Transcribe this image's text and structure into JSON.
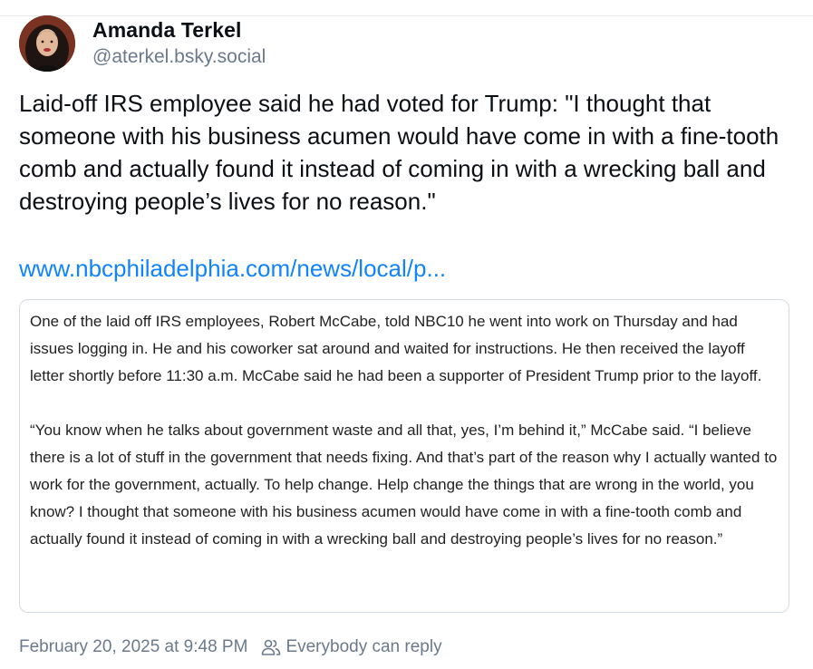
{
  "author": {
    "display_name": "Amanda Terkel",
    "handle": "@aterkel.bsky.social",
    "avatar_icon": "avatar-photo"
  },
  "post": {
    "text": "Laid-off IRS employee said he had voted for Trump: \"I thought that someone with his business acumen would have come in with a fine-tooth comb and actually found it instead of coming in with a wrecking ball and destroying people’s lives for no reason.\"",
    "link_text": "www.nbcphiladelphia.com/news/local/p..."
  },
  "quote": {
    "paragraph_1": "One of the laid off IRS employees, Robert McCabe, told NBC10 he went into work on Thursday and had issues logging in. He and his coworker sat around and waited for instructions. He then received the layoff letter shortly before 11:30 a.m. McCabe said he had been a supporter of President Trump prior to the layoff.",
    "paragraph_2": "“You know when he talks about government waste and all that, yes, I’m behind it,” McCabe said. “I believe there is a lot of stuff in the government that needs fixing. And that’s part of the reason why I actually wanted to work for the government, actually. To help change. Help change the things that are wrong in the world, you know? I thought that someone with his business acumen would have come in with a fine-tooth comb and actually found it instead of coming in with a wrecking ball and destroying people’s lives for no reason.”"
  },
  "footer": {
    "timestamp": "February 20, 2025 at 9:48 PM",
    "reply_setting": "Everybody can reply",
    "reply_icon": "people-icon"
  },
  "colors": {
    "link": "#1083fe",
    "secondary_text": "#6a7a8c",
    "border": "#d4dbe2"
  }
}
